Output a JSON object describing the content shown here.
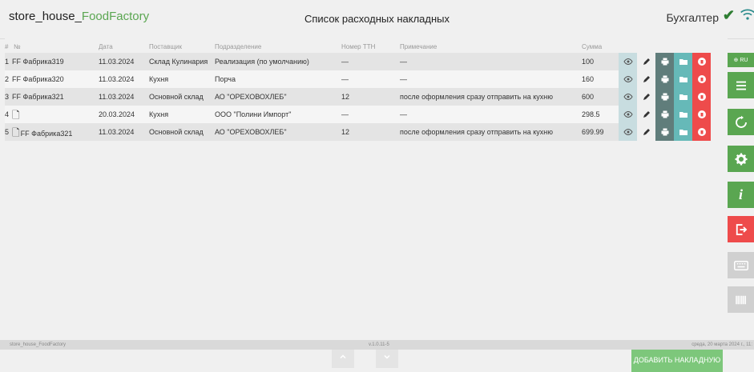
{
  "header": {
    "app_prefix": "store_house_",
    "app_brand": "FoodFactory",
    "title": "Список расходных накладных",
    "user": "Бухгалтер"
  },
  "table": {
    "columns": [
      "#",
      "№",
      "Дата",
      "Поставщик",
      "Подразделение",
      "Номер ТТН",
      "Примечание",
      "Сумма"
    ],
    "rows": [
      {
        "idx": "1",
        "num": "FF Фабрика319",
        "date": "11.03.2024",
        "supplier": "Склад Кулинария",
        "dept": "Реализация (по умолчанию)",
        "ttn": "—",
        "note": "—",
        "sum": "100"
      },
      {
        "idx": "2",
        "num": "FF Фабрика320",
        "date": "11.03.2024",
        "supplier": "Кухня",
        "dept": "Порча",
        "ttn": "—",
        "note": "—",
        "sum": "160"
      },
      {
        "idx": "3",
        "num": "FF Фабрика321",
        "date": "11.03.2024",
        "supplier": "Основной склад",
        "dept": "АО \"ОРЕХОВОХЛЕБ\"",
        "ttn": "12",
        "note": "после оформления сразу отправить на кухню",
        "sum": "600"
      },
      {
        "idx": "4",
        "num": "",
        "date": "20.03.2024",
        "supplier": "Кухня",
        "dept": "ООО \"Полини Импорт\"",
        "ttn": "—",
        "note": "—",
        "sum": "298.5"
      },
      {
        "idx": "5",
        "num": "FF Фабрика321",
        "date": "11.03.2024",
        "supplier": "Основной склад",
        "dept": "АО \"ОРЕХОВОХЛЕБ\"",
        "ttn": "12",
        "note": "после оформления сразу отправить на кухню",
        "sum": "699.99"
      }
    ]
  },
  "actions": {
    "add_label": "ДОБАВИТЬ НАКЛАДНУЮ"
  },
  "sidebar": {
    "lang": "RU"
  },
  "footer": {
    "left": "store_house_FoodFactory",
    "version": "v.1.0.11-5",
    "date": "среда, 20 марта 2024 г., 11:"
  },
  "colors": {
    "brand": "#5aa651",
    "delete": "#ee4b4b",
    "print": "#607d7b",
    "folder": "#66b9b8",
    "add": "#7dc77b"
  }
}
